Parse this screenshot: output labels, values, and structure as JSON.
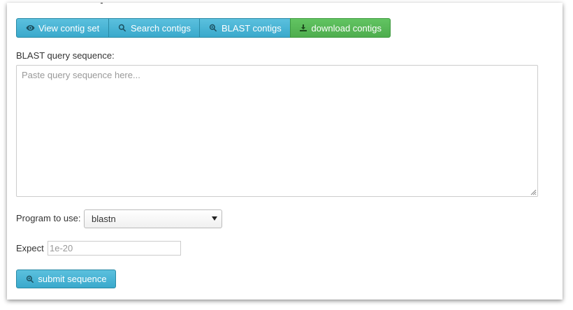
{
  "toolbar": {
    "buttons": [
      {
        "label": "View contig set",
        "icon": "eye-icon"
      },
      {
        "label": "Search contigs",
        "icon": "search-icon"
      },
      {
        "label": "BLAST contigs",
        "icon": "zoom-in-icon"
      },
      {
        "label": "download contigs",
        "icon": "download-icon"
      }
    ],
    "colors": {
      "info": "#5bc0de",
      "success": "#5cb85c"
    }
  },
  "form": {
    "query_label": "BLAST query sequence:",
    "query_placeholder": "Paste query sequence here...",
    "program_label": "Program to use:",
    "program_value": "blastn",
    "expect_label": "Expect",
    "expect_placeholder": "1e-20",
    "submit_label": "submit sequence",
    "submit_icon": "zoom-in-icon"
  }
}
